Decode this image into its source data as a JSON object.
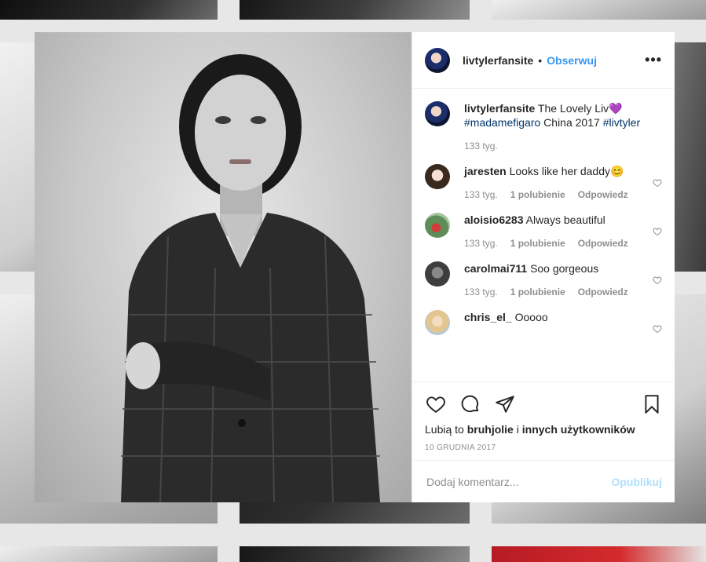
{
  "post": {
    "author": "livtylerfansite",
    "follow_label": "Obserwuj",
    "dot": "•",
    "more_label": "•••",
    "caption": {
      "user": "livtylerfansite",
      "text_before": "The Lovely Liv",
      "emoji": "💜",
      "hashtag1": "#madamefigaro",
      "text_middle": "China 2017",
      "hashtag2": "#livtyler",
      "time": "133 tyg."
    },
    "comments": [
      {
        "user": "jaresten",
        "text": "Looks like her daddy😊",
        "time": "133 tyg.",
        "likes": "1 polubienie",
        "reply": "Odpowiedz"
      },
      {
        "user": "aloisio6283",
        "text": "Always beautiful",
        "time": "133 tyg.",
        "likes": "1 polubienie",
        "reply": "Odpowiedz"
      },
      {
        "user": "carolmai711",
        "text": "Soo gorgeous",
        "time": "133 tyg.",
        "likes": "1 polubienie",
        "reply": "Odpowiedz"
      },
      {
        "user": "chris_el_",
        "text": "Ooooo",
        "time": "",
        "likes": "",
        "reply": ""
      }
    ],
    "likes": {
      "prefix": "Lubią to",
      "user": "bruhjolie",
      "middle": "i",
      "others": "innych użytkowników"
    },
    "date": "10 GRUDNIA 2017",
    "comment_input": {
      "placeholder": "Dodaj komentarz...",
      "value": ""
    },
    "publish_label": "Opublikuj"
  },
  "icons": {
    "more": "more-options-icon",
    "like": "heart-icon",
    "comment": "comment-icon",
    "share": "share-icon",
    "save": "bookmark-icon"
  },
  "colors": {
    "link": "#3897f0",
    "hashtag": "#003569",
    "muted": "#8e8e8e",
    "publish_disabled": "#b2dffc",
    "text": "#262626"
  }
}
